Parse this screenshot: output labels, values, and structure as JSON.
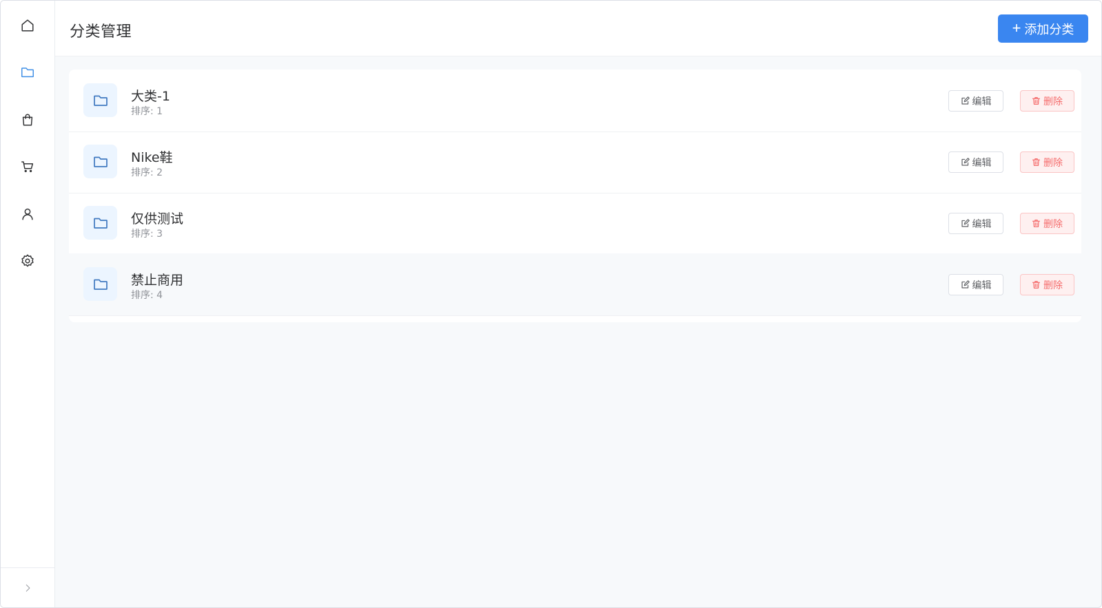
{
  "sidebar": {
    "items": [
      {
        "icon": "home-icon",
        "active": false
      },
      {
        "icon": "folder-icon",
        "active": true
      },
      {
        "icon": "shopping-bag-icon",
        "active": false
      },
      {
        "icon": "cart-icon",
        "active": false
      },
      {
        "icon": "user-icon",
        "active": false
      },
      {
        "icon": "gear-icon",
        "active": false
      }
    ],
    "footer_icon": "chevron-right-icon"
  },
  "header": {
    "title": "分类管理",
    "add_button_icon": "+",
    "add_button_label": "添加分类"
  },
  "categories": [
    {
      "name": "大类-1",
      "sort": "排序: 1"
    },
    {
      "name": "Nike鞋",
      "sort": "排序: 2"
    },
    {
      "name": "仅供测试",
      "sort": "排序: 3"
    },
    {
      "name": "禁止商用",
      "sort": "排序: 4"
    }
  ],
  "actions": {
    "edit_label": "编辑",
    "delete_label": "删除"
  },
  "colors": {
    "primary": "#3a86f0",
    "danger": "#f56c6c",
    "active_nav": "#3f8fe6"
  }
}
